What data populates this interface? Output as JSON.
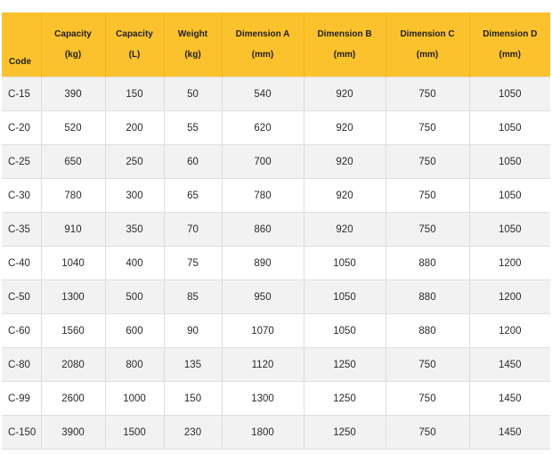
{
  "colors": {
    "header_bg": "#fcc22d",
    "row_alt_bg": "#f2f2f2",
    "border": "#dedede"
  },
  "table": {
    "headers": [
      {
        "line1": "",
        "line2": "Code"
      },
      {
        "line1": "Capacity",
        "line2": "(kg)"
      },
      {
        "line1": "Capacity",
        "line2": "(L)"
      },
      {
        "line1": "Weight",
        "line2": "(kg)"
      },
      {
        "line1": "Dimension A",
        "line2": "(mm)"
      },
      {
        "line1": "Dimension B",
        "line2": "(mm)"
      },
      {
        "line1": "Dimension C",
        "line2": "(mm)"
      },
      {
        "line1": "Dimension D",
        "line2": "(mm)"
      }
    ],
    "rows": [
      [
        "C-15",
        "390",
        "150",
        "50",
        "540",
        "920",
        "750",
        "1050"
      ],
      [
        "C-20",
        "520",
        "200",
        "55",
        "620",
        "920",
        "750",
        "1050"
      ],
      [
        "C-25",
        "650",
        "250",
        "60",
        "700",
        "920",
        "750",
        "1050"
      ],
      [
        "C-30",
        "780",
        "300",
        "65",
        "780",
        "920",
        "750",
        "1050"
      ],
      [
        "C-35",
        "910",
        "350",
        "70",
        "860",
        "920",
        "750",
        "1050"
      ],
      [
        "C-40",
        "1040",
        "400",
        "75",
        "890",
        "1050",
        "880",
        "1200"
      ],
      [
        "C-50",
        "1300",
        "500",
        "85",
        "950",
        "1050",
        "880",
        "1200"
      ],
      [
        "C-60",
        "1560",
        "600",
        "90",
        "1070",
        "1050",
        "880",
        "1200"
      ],
      [
        "C-80",
        "2080",
        "800",
        "135",
        "1120",
        "1250",
        "750",
        "1450"
      ],
      [
        "C-99",
        "2600",
        "1000",
        "150",
        "1300",
        "1250",
        "750",
        "1450"
      ],
      [
        "C-150",
        "3900",
        "1500",
        "230",
        "1800",
        "1250",
        "750",
        "1450"
      ]
    ]
  }
}
